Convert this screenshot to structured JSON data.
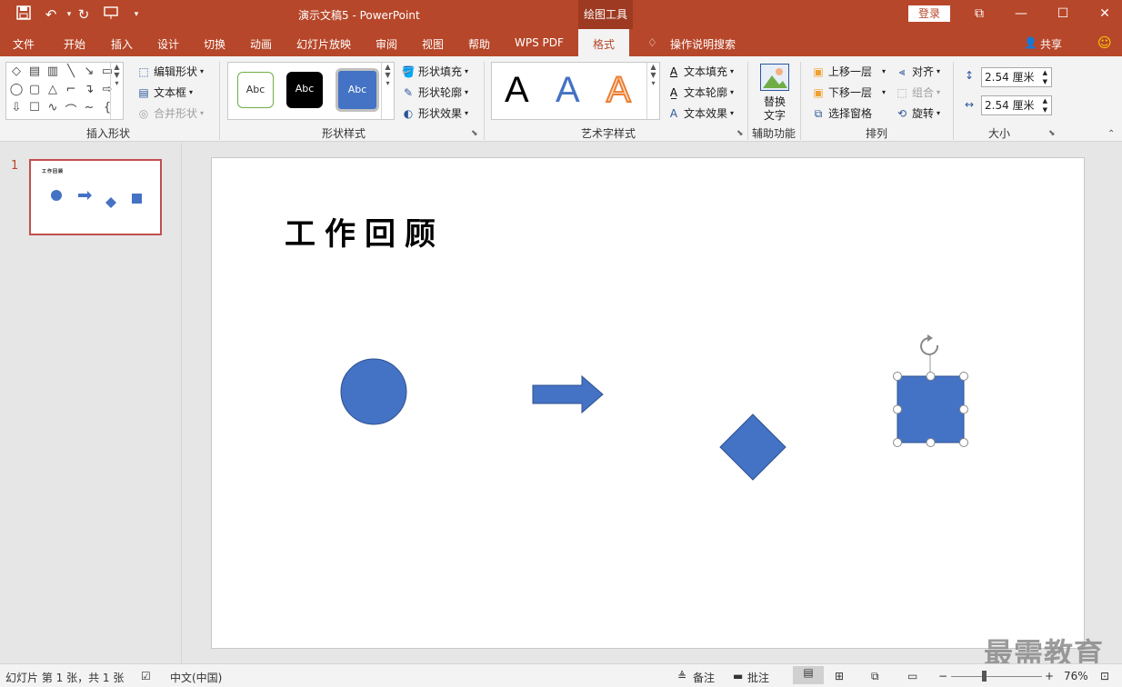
{
  "window": {
    "doc_title": "演示文稿5  -  PowerPoint",
    "context_tab": "绘图工具",
    "login_label": "登录",
    "win_min": "—",
    "win_max": "☐",
    "win_close": "✕",
    "restore": "⧉"
  },
  "tabs": [
    {
      "label": "文件"
    },
    {
      "label": "开始"
    },
    {
      "label": "插入"
    },
    {
      "label": "设计"
    },
    {
      "label": "切换"
    },
    {
      "label": "动画"
    },
    {
      "label": "幻灯片放映"
    },
    {
      "label": "审阅"
    },
    {
      "label": "视图"
    },
    {
      "label": "帮助"
    },
    {
      "label": "WPS PDF"
    },
    {
      "label": "格式"
    }
  ],
  "tell_me": "操作说明搜索",
  "share": "共享",
  "ribbon": {
    "insert_shapes": {
      "label": "插入形状",
      "edit_shape": "编辑形状",
      "text_box": "文本框",
      "merge_shapes": "合并形状"
    },
    "shape_styles": {
      "label": "形状样式",
      "preset": "Abc",
      "fill": "形状填充",
      "outline": "形状轮廓",
      "effects": "形状效果"
    },
    "art_styles": {
      "label": "艺术字样式",
      "letter": "A",
      "text_fill": "文本填充",
      "text_outline": "文本轮廓",
      "text_effects": "文本效果"
    },
    "accessibility": {
      "label": "辅助功能",
      "alt_text_1": "替换",
      "alt_text_2": "文字"
    },
    "arrange": {
      "label": "排列",
      "bring_forward": "上移一层",
      "send_backward": "下移一层",
      "selection_pane": "选择窗格",
      "align": "对齐",
      "group": "组合",
      "rotate": "旋转"
    },
    "size": {
      "label": "大小",
      "height": "2.54 厘米",
      "width": "2.54 厘米"
    }
  },
  "slide_panel": {
    "number": "1",
    "thumb_title": "工作回顾"
  },
  "slide": {
    "title": "工作回顾",
    "shape_color": "#4472c4"
  },
  "status": {
    "slide_info": "幻灯片 第 1 张，共 1 张",
    "language": "中文(中国)",
    "notes": "备注",
    "comments": "批注",
    "zoom": "76%"
  },
  "watermark": "最需教育"
}
